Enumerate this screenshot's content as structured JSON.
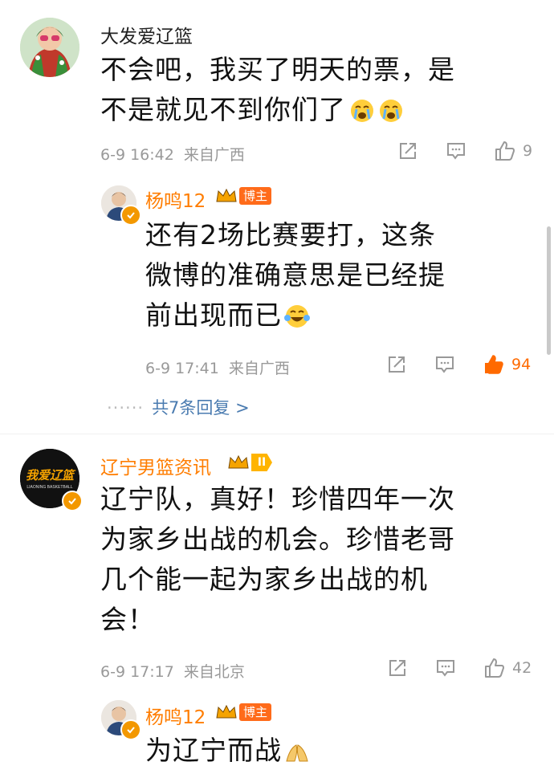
{
  "comments": [
    {
      "user": "大发爱辽篮",
      "text_lines": [
        "不会吧，我买了明天的票，是",
        "不是就见不到你们了"
      ],
      "emojis": [
        "crying-emoji",
        "crying-emoji"
      ],
      "time": "6-9 16:42",
      "location": "来自广西",
      "likes": "9",
      "reply": {
        "user": "杨鸣12",
        "badge": "博主",
        "text_lines": [
          "还有2场比赛要打，这条",
          "微博的准确意思是已经提",
          "前出现而已"
        ],
        "emojis": [
          "laugh-cry-emoji"
        ],
        "time": "6-9 17:41",
        "location": "来自广西",
        "likes": "94",
        "liked": true
      },
      "more_replies": "共7条回复 >",
      "more_dots": "······"
    },
    {
      "user": "辽宁男篮资讯",
      "badge": "II",
      "avatar_text": "我爱辽篮",
      "avatar_subtext": "LIAONING BASKETBALL",
      "text_lines": [
        "辽宁队，真好！珍惜四年一次",
        "为家乡出战的机会。珍惜老哥",
        "几个能一起为家乡出战的机",
        "会！"
      ],
      "time": "6-9 17:17",
      "location": "来自北京",
      "likes": "42",
      "reply": {
        "user": "杨鸣12",
        "badge": "博主",
        "text_lines": [
          "为辽宁而战"
        ],
        "emojis": [
          "praying-hands-emoji"
        ]
      }
    }
  ],
  "colors": {
    "orange": "#ff7d00",
    "link_blue": "#4a7bb0",
    "meta_gray": "#999999",
    "liked_orange": "#ff6a00"
  }
}
